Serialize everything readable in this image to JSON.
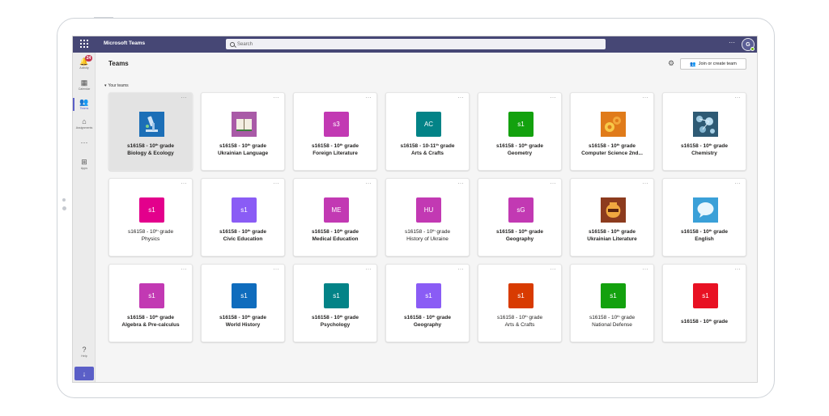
{
  "app": {
    "title": "Microsoft Teams",
    "avatar_initials": "G"
  },
  "search": {
    "placeholder": "Search"
  },
  "rail": [
    {
      "id": "activity",
      "label": "Activity",
      "glyph": "🔔",
      "badge": "24"
    },
    {
      "id": "calendar",
      "label": "Calendar",
      "glyph": "▦"
    },
    {
      "id": "teams",
      "label": "Teams",
      "glyph": "👥",
      "active": true
    },
    {
      "id": "assignments",
      "label": "Assignments",
      "glyph": "⌂"
    },
    {
      "id": "more",
      "label": "",
      "glyph": "···"
    },
    {
      "id": "apps",
      "label": "Apps",
      "glyph": "⊞"
    },
    {
      "id": "help",
      "label": "Help",
      "glyph": "?"
    }
  ],
  "page": {
    "title": "Teams",
    "section_label": "Your teams",
    "join_label": "Join or create team"
  },
  "colors": {
    "topbar": "#464775",
    "accent": "#5b5fc7"
  },
  "teams": [
    {
      "line1": "s16158 - 10",
      "sup": "th",
      "line1_tail": " grade",
      "line2": "Biology & Ecology",
      "bold": true,
      "tile_text": "",
      "tile_icon": "microscope",
      "tile_color": "#1c6fb7",
      "selected": true
    },
    {
      "line1": "s16158 - 10",
      "sup": "th",
      "line1_tail": " grade",
      "line2": "Ukrainian Language",
      "bold": true,
      "tile_text": "",
      "tile_icon": "book",
      "tile_color": "#a95aa7"
    },
    {
      "line1": "s16158 - 10",
      "sup": "th",
      "line1_tail": " grade",
      "line2": "Foreign Literature",
      "bold": true,
      "tile_text": "s3",
      "tile_color": "#c239b3"
    },
    {
      "line1": "s16158 - 10-11",
      "sup": "th",
      "line1_tail": " grade",
      "line2": "Arts & Crafts",
      "bold": true,
      "tile_text": "AC",
      "tile_color": "#038387"
    },
    {
      "line1": "s16158 - 10",
      "sup": "th",
      "line1_tail": " grade",
      "line2": "Geometry",
      "bold": true,
      "tile_text": "s1",
      "tile_color": "#13a10e"
    },
    {
      "line1": "s16158 - 10",
      "sup": "th",
      "line1_tail": " grade",
      "line2": "Computer Science  2nd...",
      "bold": true,
      "tile_text": "",
      "tile_icon": "gears",
      "tile_color": "#e07b1a"
    },
    {
      "line1": "s16158 - 10",
      "sup": "th",
      "line1_tail": " grade",
      "line2": "Chemistry",
      "bold": true,
      "tile_text": "",
      "tile_icon": "molecules",
      "tile_color": "#3d6f8e"
    },
    {
      "line1": "s16158 - 10",
      "sup": "th",
      "line1_tail": " grade",
      "line2": "Physics",
      "bold": false,
      "tile_text": "s1",
      "tile_color": "#e3008c"
    },
    {
      "line1": "s16158 - 10",
      "sup": "th",
      "line1_tail": " grade",
      "line2": "Civic Education",
      "bold": true,
      "tile_text": "s1",
      "tile_color": "#8a5cf5"
    },
    {
      "line1": "s16158 - 10",
      "sup": "th",
      "line1_tail": " grade",
      "line2": "Medical Education",
      "bold": true,
      "tile_text": "ME",
      "tile_color": "#c239b3"
    },
    {
      "line1": "s16158 - 10",
      "sup": "th",
      "line1_tail": " grade",
      "line2": "History of Ukraine",
      "bold": false,
      "tile_text": "HU",
      "tile_color": "#c239b3"
    },
    {
      "line1": "s16158 - 10",
      "sup": "th",
      "line1_tail": " grade",
      "line2": "Geography",
      "bold": true,
      "tile_text": "sG",
      "tile_color": "#c239b3"
    },
    {
      "line1": "s16158 - 10",
      "sup": "th",
      "line1_tail": " grade",
      "line2": "Ukrainian Literature",
      "bold": true,
      "tile_text": "",
      "tile_icon": "vase",
      "tile_color": "#8c3b1e"
    },
    {
      "line1": "s16158 - 10",
      "sup": "th",
      "line1_tail": " grade",
      "line2": "English",
      "bold": true,
      "tile_text": "",
      "tile_icon": "speech-bubble",
      "tile_color": "#3aa0d8"
    },
    {
      "line1": "s16158 - 10",
      "sup": "th",
      "line1_tail": " grade",
      "line2": "Algebra & Pre-calculus",
      "bold": true,
      "tile_text": "s1",
      "tile_color": "#c239b3"
    },
    {
      "line1": "s16158 - 10",
      "sup": "th",
      "line1_tail": " grade",
      "line2": "World History",
      "bold": true,
      "tile_text": "s1",
      "tile_color": "#0f6cbd"
    },
    {
      "line1": "s16158 - 10",
      "sup": "th",
      "line1_tail": " grade",
      "line2": "Psychology",
      "bold": true,
      "tile_text": "s1",
      "tile_color": "#038387"
    },
    {
      "line1": "s16158 - 10",
      "sup": "th",
      "line1_tail": " grade",
      "line2": "Geography",
      "bold": true,
      "tile_text": "s1",
      "tile_color": "#8a5cf5"
    },
    {
      "line1": "s16158 - 10",
      "sup": "th",
      "line1_tail": " grade",
      "line2": "Arts & Crafts",
      "bold": false,
      "tile_text": "s1",
      "tile_color": "#d83b01"
    },
    {
      "line1": "s16158 - 10",
      "sup": "th",
      "line1_tail": " grade",
      "line2": "National Defense",
      "bold": false,
      "tile_text": "s1",
      "tile_color": "#13a10e"
    },
    {
      "line1": "s16158 - 10",
      "sup": "th",
      "line1_tail": " grade",
      "line2": "",
      "bold": true,
      "tile_text": "s1",
      "tile_color": "#e81123"
    }
  ]
}
